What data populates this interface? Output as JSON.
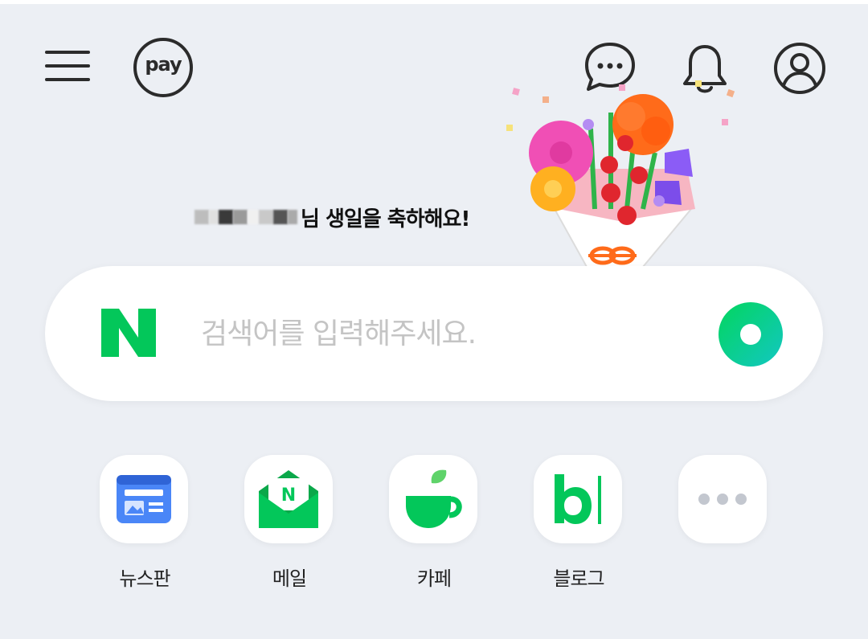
{
  "header": {
    "menu_icon": "hamburger-menu-icon",
    "pay_label": "pay",
    "talk_icon": "chat-bubble-icon",
    "notification_icon": "bell-icon",
    "profile_icon": "user-profile-icon"
  },
  "greeting": {
    "text": "님 생일을 축하해요!"
  },
  "search": {
    "logo": "N",
    "placeholder": "검색어를 입력해주세요.",
    "green_dot_icon": "green-dot-icon"
  },
  "shortcuts": [
    {
      "label": "뉴스판",
      "icon": "newspaper-icon"
    },
    {
      "label": "메일",
      "icon": "mail-envelope-icon"
    },
    {
      "label": "카페",
      "icon": "cafe-cup-icon"
    },
    {
      "label": "블로그",
      "icon": "blog-b-icon"
    },
    {
      "label": "",
      "icon": "more-dots-icon"
    }
  ],
  "colors": {
    "background": "#eceff4",
    "brand_green": "#03c75a",
    "news_blue": "#3e7bf2"
  }
}
